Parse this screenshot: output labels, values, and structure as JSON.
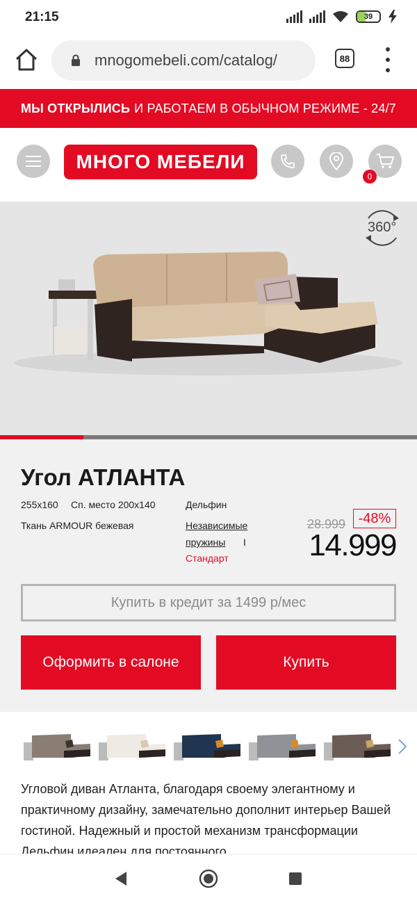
{
  "status_bar": {
    "time": "21:15",
    "battery_level": "39",
    "icons": [
      "signal-icon",
      "signal-icon",
      "wifi-icon",
      "battery-icon",
      "charging-icon"
    ]
  },
  "browser": {
    "url": "mnogomebeli.com/catalog/",
    "tab_count": "88",
    "icons": [
      "home-icon",
      "lock-icon",
      "menu-dots-icon"
    ]
  },
  "promo": {
    "bold": "МЫ ОТКРЫЛИСЬ",
    "text": "И РАБОТАЕМ В ОБЫЧНОМ РЕЖИМЕ - 24/7"
  },
  "header": {
    "logo_text": "МНОГО МЕБЕЛИ",
    "cart_count": "0",
    "icons": [
      "hamburger-icon",
      "phone-icon",
      "location-pin-icon",
      "cart-icon"
    ]
  },
  "gallery": {
    "badge_360": "360°",
    "progress_fraction": 0.2
  },
  "product": {
    "title": "Угол АТЛАНТА",
    "size": "255x160",
    "sleep_area": "Сп. место 200x140",
    "fabric": "Ткань ARMOUR бежевая",
    "mechanism": "Дельфин",
    "springs_line1": "Независимые",
    "springs_line2": "пружины",
    "separator": "I",
    "variant": "Стандарт",
    "old_price": "28.999",
    "discount": "-48%",
    "price": "14.999",
    "credit_label": "Купить в кредит за 1499 р/мес",
    "salon_label": "Оформить в салоне",
    "buy_label": "Купить"
  },
  "thumbnails": {
    "colors": [
      "#8a7e72",
      "#efeae2",
      "#1f3550",
      "#8f9296",
      "#6b5d55"
    ],
    "cushion_colors": [
      "#3b3532",
      "#d7c9b0",
      "#d88b2a",
      "#d88b2a",
      "#c9a46a"
    ]
  },
  "description": "Угловой диван Атланта, благодаря своему элегантному и практичному дизайну, замечательно дополнит интерьер Вашей гостиной. Надежный и простой механизм трансформации Дельфин идеален для постоянного",
  "colors": {
    "brand_red": "#e30b24",
    "gray_circle": "#c8c8c8"
  }
}
